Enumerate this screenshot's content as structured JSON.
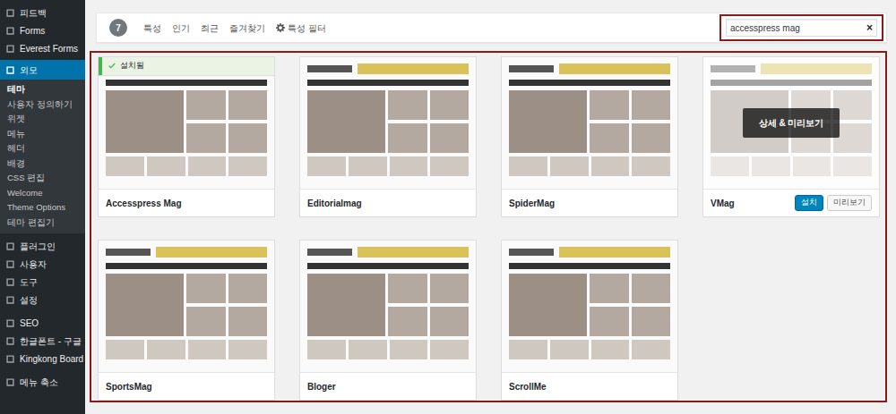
{
  "sidebar": {
    "items": [
      {
        "label": "피드백",
        "selected": false
      },
      {
        "label": "Forms",
        "selected": false
      },
      {
        "label": "Everest Forms",
        "selected": false
      },
      {
        "label": "외모",
        "selected": true
      },
      {
        "label": "플러그인",
        "selected": false
      },
      {
        "label": "사용자",
        "selected": false
      },
      {
        "label": "도구",
        "selected": false
      },
      {
        "label": "설정",
        "selected": false
      },
      {
        "label": "SEO",
        "selected": false
      },
      {
        "label": "한글폰트 - 구글",
        "selected": false
      },
      {
        "label": "Kingkong Board",
        "selected": false
      },
      {
        "label": "메뉴 축소",
        "selected": false
      }
    ],
    "submenu": [
      {
        "label": "테마",
        "selected": true
      },
      {
        "label": "사용자 정의하기",
        "selected": false
      },
      {
        "label": "위젯",
        "selected": false
      },
      {
        "label": "메뉴",
        "selected": false
      },
      {
        "label": "헤더",
        "selected": false
      },
      {
        "label": "배경",
        "selected": false
      },
      {
        "label": "CSS 편집",
        "selected": false
      },
      {
        "label": "Welcome",
        "selected": false
      },
      {
        "label": "Theme Options",
        "selected": false
      },
      {
        "label": "테마 편집기",
        "selected": false
      }
    ]
  },
  "filter_bar": {
    "count": "7",
    "tabs": [
      {
        "label": "특성",
        "selected": false
      },
      {
        "label": "인기",
        "selected": false
      },
      {
        "label": "최근",
        "selected": false
      },
      {
        "label": "즐겨찾기",
        "selected": false
      }
    ],
    "feature_filter": "특성 필터",
    "search": {
      "value": "accesspress mag",
      "clear": "×"
    }
  },
  "themes": [
    {
      "name": "Accesspress Mag",
      "installed": true,
      "hovered": false
    },
    {
      "name": "Editorialmag",
      "installed": false,
      "hovered": false
    },
    {
      "name": "SpiderMag",
      "installed": false,
      "hovered": false
    },
    {
      "name": "VMag",
      "installed": false,
      "hovered": true
    },
    {
      "name": "SportsMag",
      "installed": false,
      "hovered": false
    },
    {
      "name": "Bloger",
      "installed": false,
      "hovered": false
    },
    {
      "name": "ScrollMe",
      "installed": false,
      "hovered": false
    }
  ],
  "theme_labels": {
    "installed": "설치됨",
    "details": "상세 & 미리보기",
    "install": "설치",
    "preview": "미리보기"
  }
}
